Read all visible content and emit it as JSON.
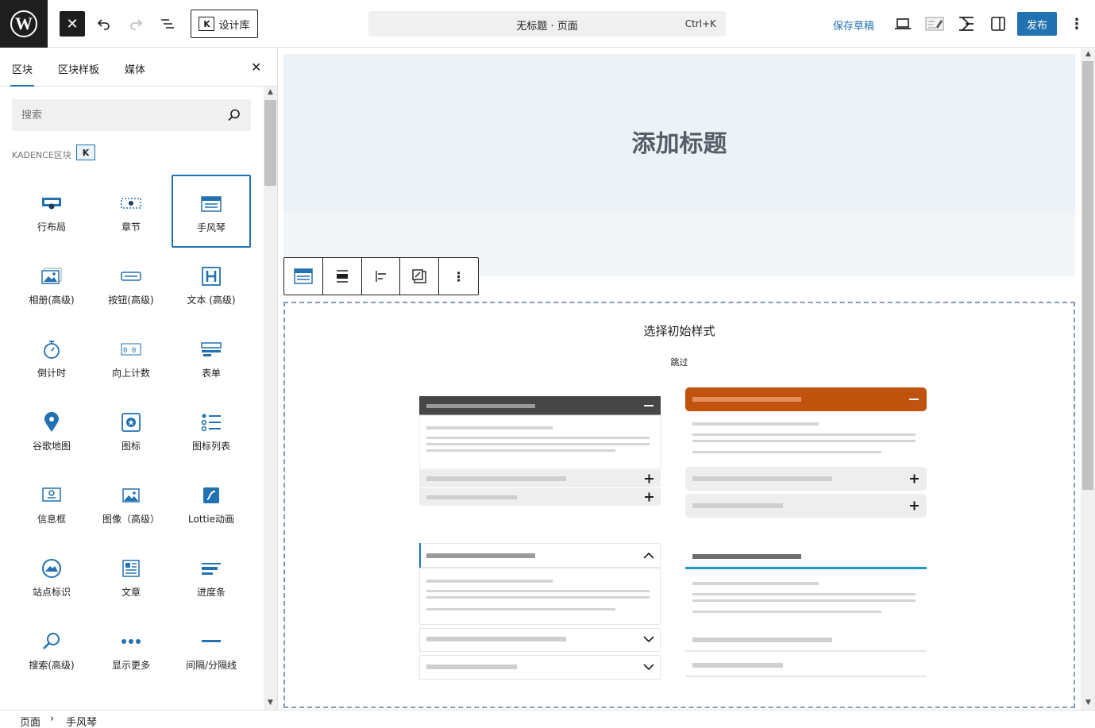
{
  "toolbar": {
    "design_library_label": "设计库",
    "doc_title": "无标题 · 页面",
    "shortcut": "Ctrl+K",
    "save_draft": "保存草稿",
    "publish": "发布"
  },
  "sidebar": {
    "tabs": [
      {
        "label": "区块",
        "active": true
      },
      {
        "label": "区块样板",
        "active": false
      },
      {
        "label": "媒体",
        "active": false
      }
    ],
    "search_placeholder": "搜索",
    "section_label": "KADENCE区块",
    "blocks": [
      {
        "label": "行布局",
        "icon": "row-layout-icon"
      },
      {
        "label": "章节",
        "icon": "section-icon"
      },
      {
        "label": "手风琴",
        "icon": "accordion-icon",
        "selected": true
      },
      {
        "label": "相册(高级)",
        "icon": "gallery-icon"
      },
      {
        "label": "按钮(高级)",
        "icon": "button-icon"
      },
      {
        "label": "文本 (高级)",
        "icon": "heading-icon"
      },
      {
        "label": "倒计时",
        "icon": "countdown-icon"
      },
      {
        "label": "向上计数",
        "icon": "count-up-icon"
      },
      {
        "label": "表单",
        "icon": "form-icon"
      },
      {
        "label": "谷歌地图",
        "icon": "map-pin-icon"
      },
      {
        "label": "图标",
        "icon": "icon-block-icon"
      },
      {
        "label": "图标列表",
        "icon": "icon-list-icon"
      },
      {
        "label": "信息框",
        "icon": "info-box-icon"
      },
      {
        "label": "图像（高级）",
        "icon": "image-icon"
      },
      {
        "label": "Lottie动画",
        "icon": "lottie-icon"
      },
      {
        "label": "站点标识",
        "icon": "site-identity-icon"
      },
      {
        "label": "文章",
        "icon": "posts-icon"
      },
      {
        "label": "进度条",
        "icon": "progress-bar-icon"
      },
      {
        "label": "搜索(高级)",
        "icon": "search-advanced-icon"
      },
      {
        "label": "显示更多",
        "icon": "show-more-icon"
      },
      {
        "label": "间隔/分隔线",
        "icon": "spacer-icon"
      }
    ]
  },
  "canvas": {
    "hero_title": "添加标题",
    "placeholder_title": "选择初始样式",
    "skip_label": "跳过"
  },
  "breadcrumb": {
    "page": "页面",
    "block": "手风琴"
  },
  "colors": {
    "accent": "#2271b1",
    "orange": "#c0540f",
    "dark_header": "#464646"
  }
}
